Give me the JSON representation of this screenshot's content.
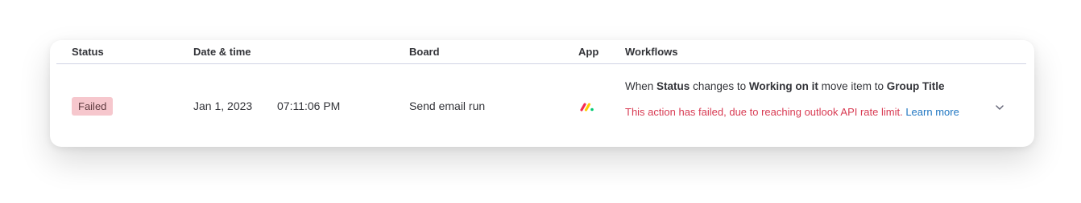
{
  "table": {
    "headers": {
      "status": "Status",
      "datetime": "Date & time",
      "board": "Board",
      "app": "App",
      "workflows": "Workflows"
    },
    "rows": [
      {
        "status": "Failed",
        "date": "Jan 1, 2023",
        "time": "07:11:06 PM",
        "board": "Send email run",
        "app_icon": "monday-logo-icon",
        "workflow": {
          "when": "When",
          "status_label": "Status",
          "changes_to": "changes to",
          "target_status": "Working on it",
          "move_item_to": "move item to",
          "group": "Group Title",
          "error": "This action has failed, due to reaching outlook API rate limit.",
          "link_text": "Learn more"
        }
      }
    ]
  },
  "colors": {
    "failed_badge_bg": "#f6c7cd",
    "error_text": "#d83a52",
    "link": "#1f76c2",
    "header_divider": "#d0d4e4"
  }
}
